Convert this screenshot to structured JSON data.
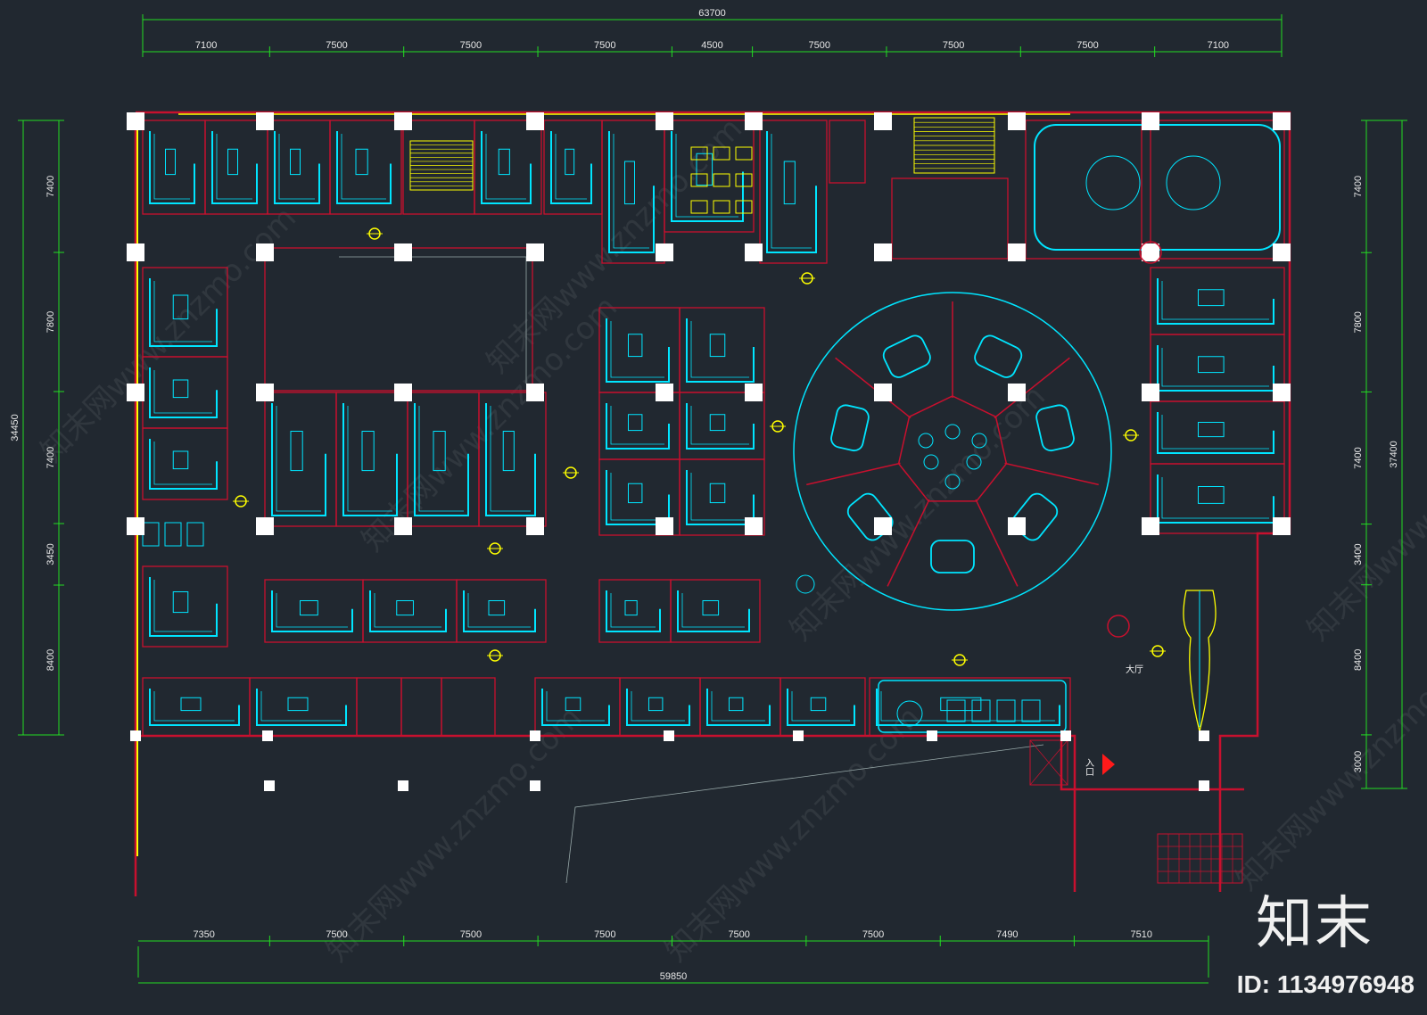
{
  "dimensions": {
    "top_total": "63700",
    "top_segments": [
      "7100",
      "7500",
      "7500",
      "7500",
      "4500",
      "7500",
      "7500",
      "7500",
      "7100"
    ],
    "bottom_total": "59850",
    "bottom_segments": [
      "7350",
      "7500",
      "7500",
      "7500",
      "7500",
      "7500",
      "7490",
      "7510"
    ],
    "left_total": "34450",
    "left_segments": [
      "7400",
      "7800",
      "7400",
      "3450",
      "8400"
    ],
    "right_total": "37400",
    "right_segments": [
      "7400",
      "7800",
      "7400",
      "3400",
      "8400",
      "3000"
    ]
  },
  "labels": {
    "lobby": "大厅",
    "entrance": "入口"
  },
  "watermark": {
    "text": "知末网www.znzmo.com",
    "logo": "知末",
    "id": "ID: 1134976948"
  },
  "colors": {
    "background": "#212830",
    "walls": "#c8102e",
    "furniture": "#00e5ff",
    "dimension_lines": "#22dd22",
    "columns": "#ffffff",
    "accent_yellow": "#ffff00",
    "entrance_arrow": "#ff1a1a"
  }
}
